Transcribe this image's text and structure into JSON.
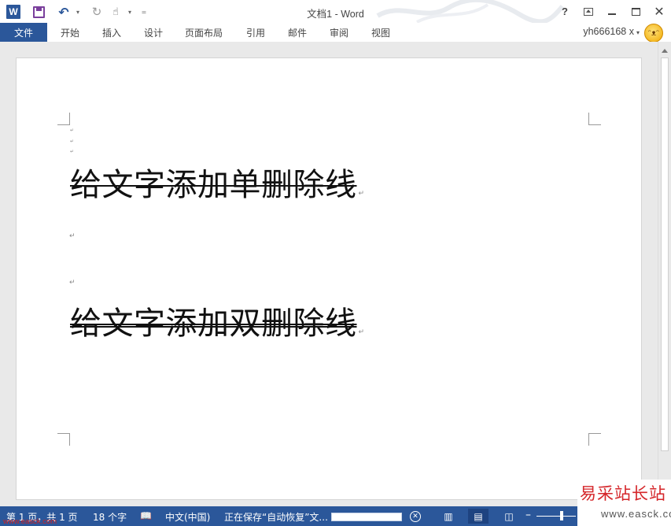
{
  "window": {
    "title": "文档1 - Word",
    "help_label": "?",
    "colors": {
      "accent": "#2b579a",
      "page": "#ffffff",
      "workspace": "#e9e9e9"
    }
  },
  "qat": {
    "app_icon": "word-icon",
    "app_icon_letter": "W",
    "save_icon": "save-icon",
    "undo_icon": "undo-icon",
    "redo_icon": "redo-icon",
    "touch_icon": "touch-mode-icon",
    "customize_icon": "customize-qat-icon"
  },
  "ribbon": {
    "tabs": [
      {
        "label": "文件",
        "active": true
      },
      {
        "label": "开始"
      },
      {
        "label": "插入"
      },
      {
        "label": "设计"
      },
      {
        "label": "页面布局"
      },
      {
        "label": "引用"
      },
      {
        "label": "邮件"
      },
      {
        "label": "审阅"
      },
      {
        "label": "视图"
      }
    ],
    "user": "yh666168 x"
  },
  "document": {
    "line1": "给文字添加单删除线",
    "line2": "给文字添加双删除线",
    "paragraph_mark": "↵"
  },
  "statusbar": {
    "page": "第 1 页，共 1 页",
    "words": "18 个字",
    "language": "中文(中国)",
    "saving": "正在保存“自动恢复”文...",
    "save_progress": 0.0
  },
  "watermark": {
    "title": "易采站长站",
    "url": "www.easck.com",
    "stamp": "www.easck.com"
  }
}
